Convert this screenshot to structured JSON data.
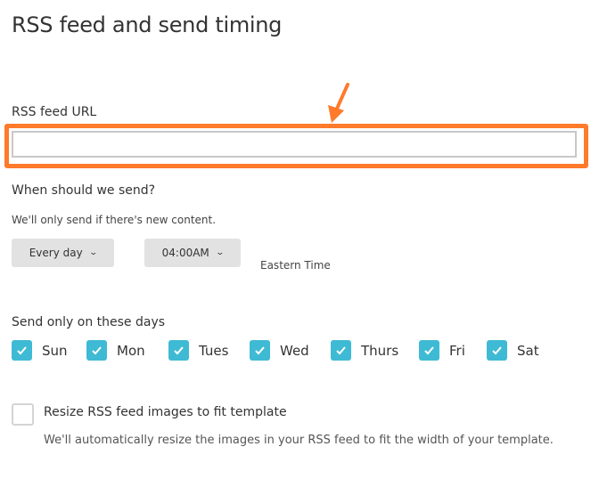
{
  "title": "RSS feed and send timing",
  "rss_url": {
    "label": "RSS feed URL",
    "value": "",
    "placeholder": ""
  },
  "annotation": {
    "color": "#ff7a2a",
    "shape": "arrow-and-box"
  },
  "timing": {
    "heading": "When should we send?",
    "note": "We'll only send if there's new content.",
    "frequency": "Every day",
    "time": "04:00AM",
    "timezone": "Eastern Time"
  },
  "days": {
    "heading": "Send only on these days",
    "items": [
      {
        "label": "Sun",
        "checked": true
      },
      {
        "label": "Mon",
        "checked": true
      },
      {
        "label": "Tues",
        "checked": true
      },
      {
        "label": "Wed",
        "checked": true
      },
      {
        "label": "Thurs",
        "checked": true
      },
      {
        "label": "Fri",
        "checked": true
      },
      {
        "label": "Sat",
        "checked": true
      }
    ]
  },
  "resize": {
    "label": "Resize RSS feed images to fit template",
    "checked": false,
    "description": "We'll automatically resize the images in your RSS feed to fit the width of your template."
  },
  "colors": {
    "accent": "#3fbad4",
    "highlight": "#ff7a2a"
  },
  "icons": {
    "dropdown": "chevron-down-icon",
    "check": "checkmark-icon"
  }
}
